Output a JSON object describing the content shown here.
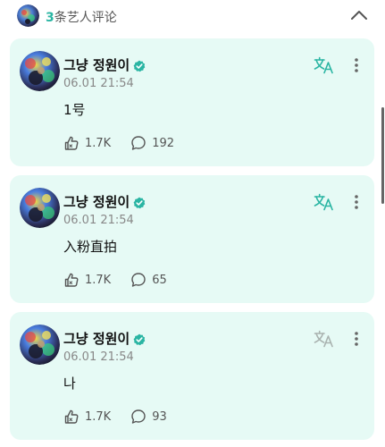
{
  "header": {
    "count": "3",
    "title": "条艺人评论"
  },
  "comments": [
    {
      "name": "그냥 정원이",
      "time": "06.01 21:54",
      "text": "1号",
      "likes": "1.7K",
      "replies": "192"
    },
    {
      "name": "그냥 정원이",
      "time": "06.01 21:54",
      "text": "入粉直拍",
      "likes": "1.7K",
      "replies": "65"
    },
    {
      "name": "그냥 정원이",
      "time": "06.01 21:54",
      "text": "나",
      "likes": "1.7K",
      "replies": "93"
    }
  ],
  "colors": {
    "accent": "#2ab5a3",
    "card_bg": "#e6faf5",
    "translate_active": "#2ab5a3",
    "translate_inactive": "#aab3b0"
  },
  "icons": {
    "translate": "translate-icon",
    "more": "more-vertical-icon",
    "like": "like-hand-icon",
    "reply": "comment-bubble-icon",
    "verified": "verified-check-icon",
    "collapse": "chevron-up-icon"
  }
}
